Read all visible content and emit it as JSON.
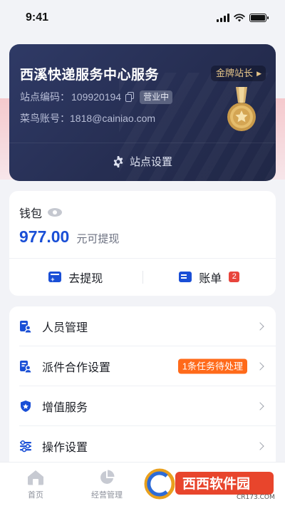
{
  "status_bar": {
    "time": "9:41"
  },
  "station": {
    "name": "西溪快递服务中心服务",
    "rank": "金牌站长",
    "code_label": "站点编码：",
    "code_value": "109920194",
    "status": "营业中",
    "account_label": "菜鸟账号：",
    "account_value": "1818@cainiao.com",
    "settings_label": "站点设置"
  },
  "wallet": {
    "title": "钱包",
    "amount": "977.00",
    "amount_label": "元可提现",
    "withdraw_label": "去提现",
    "bill_label": "账单",
    "bill_count": "2"
  },
  "menu": {
    "items": [
      {
        "label": "人员管理"
      },
      {
        "label": "派件合作设置",
        "tag": "1条任务待处理"
      },
      {
        "label": "增值服务"
      },
      {
        "label": "操作设置"
      }
    ]
  },
  "tabs": [
    {
      "label": "首页",
      "icon": "home-icon"
    },
    {
      "label": "经营管理",
      "icon": "pie-chart-icon"
    }
  ],
  "watermark": {
    "text": "西西软件园",
    "sub": "CR173.COM"
  },
  "colors": {
    "accent": "#1a4fd6",
    "card_dark": "#262e52",
    "gold": "#e7c68a",
    "orange": "#ff6a1a",
    "badge_red": "#e8453c"
  }
}
